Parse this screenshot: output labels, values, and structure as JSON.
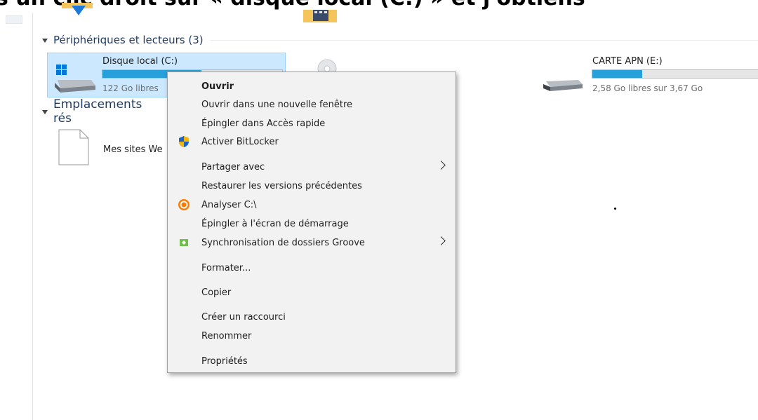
{
  "caption": "s un clic droit sur « disque local (C:) » et j'obtiens",
  "groups": {
    "devices": "Périphériques et lecteurs (3)",
    "network": "Emplacements rés"
  },
  "drives": [
    {
      "name": "Disque local (C:)",
      "free_text": "122 Go libres",
      "used_fraction": 0.55
    },
    {
      "name": "CARTE APN (E:)",
      "free_text": "2,58 Go libres sur 3,67 Go",
      "used_fraction": 0.3
    }
  ],
  "network_items": [
    {
      "label": "Mes sites We"
    }
  ],
  "context_menu": {
    "items": [
      {
        "label": "Ouvrir",
        "bold": true,
        "icon": "",
        "submenu": false
      },
      {
        "label": "Ouvrir dans une nouvelle fenêtre",
        "bold": false,
        "icon": "",
        "submenu": false
      },
      {
        "label": "Épingler dans Accès rapide",
        "bold": false,
        "icon": "",
        "submenu": false
      },
      {
        "label": "Activer BitLocker",
        "bold": false,
        "icon": "shield-icon",
        "submenu": false
      },
      {
        "label": "Partager avec",
        "bold": false,
        "icon": "",
        "submenu": true
      },
      {
        "label": "Restaurer les versions précédentes",
        "bold": false,
        "icon": "",
        "submenu": false
      },
      {
        "label": "Analyser C:\\",
        "bold": false,
        "icon": "avast-icon",
        "submenu": false
      },
      {
        "label": "Épingler à l'écran de démarrage",
        "bold": false,
        "icon": "",
        "submenu": false
      },
      {
        "label": "Synchronisation de dossiers Groove",
        "bold": false,
        "icon": "groove-icon",
        "submenu": true
      },
      {
        "label": "Formater...",
        "bold": false,
        "icon": "",
        "submenu": false
      },
      {
        "label": "Copier",
        "bold": false,
        "icon": "",
        "submenu": false
      },
      {
        "label": "Créer un raccourci",
        "bold": false,
        "icon": "",
        "submenu": false
      },
      {
        "label": "Renommer",
        "bold": false,
        "icon": "",
        "submenu": false
      },
      {
        "label": "Propriétés",
        "bold": false,
        "icon": "",
        "submenu": false
      }
    ]
  },
  "colors": {
    "selection_bg": "#cce8ff",
    "bar_fill": "#26a0da",
    "menu_bg": "#f2f2f2"
  }
}
